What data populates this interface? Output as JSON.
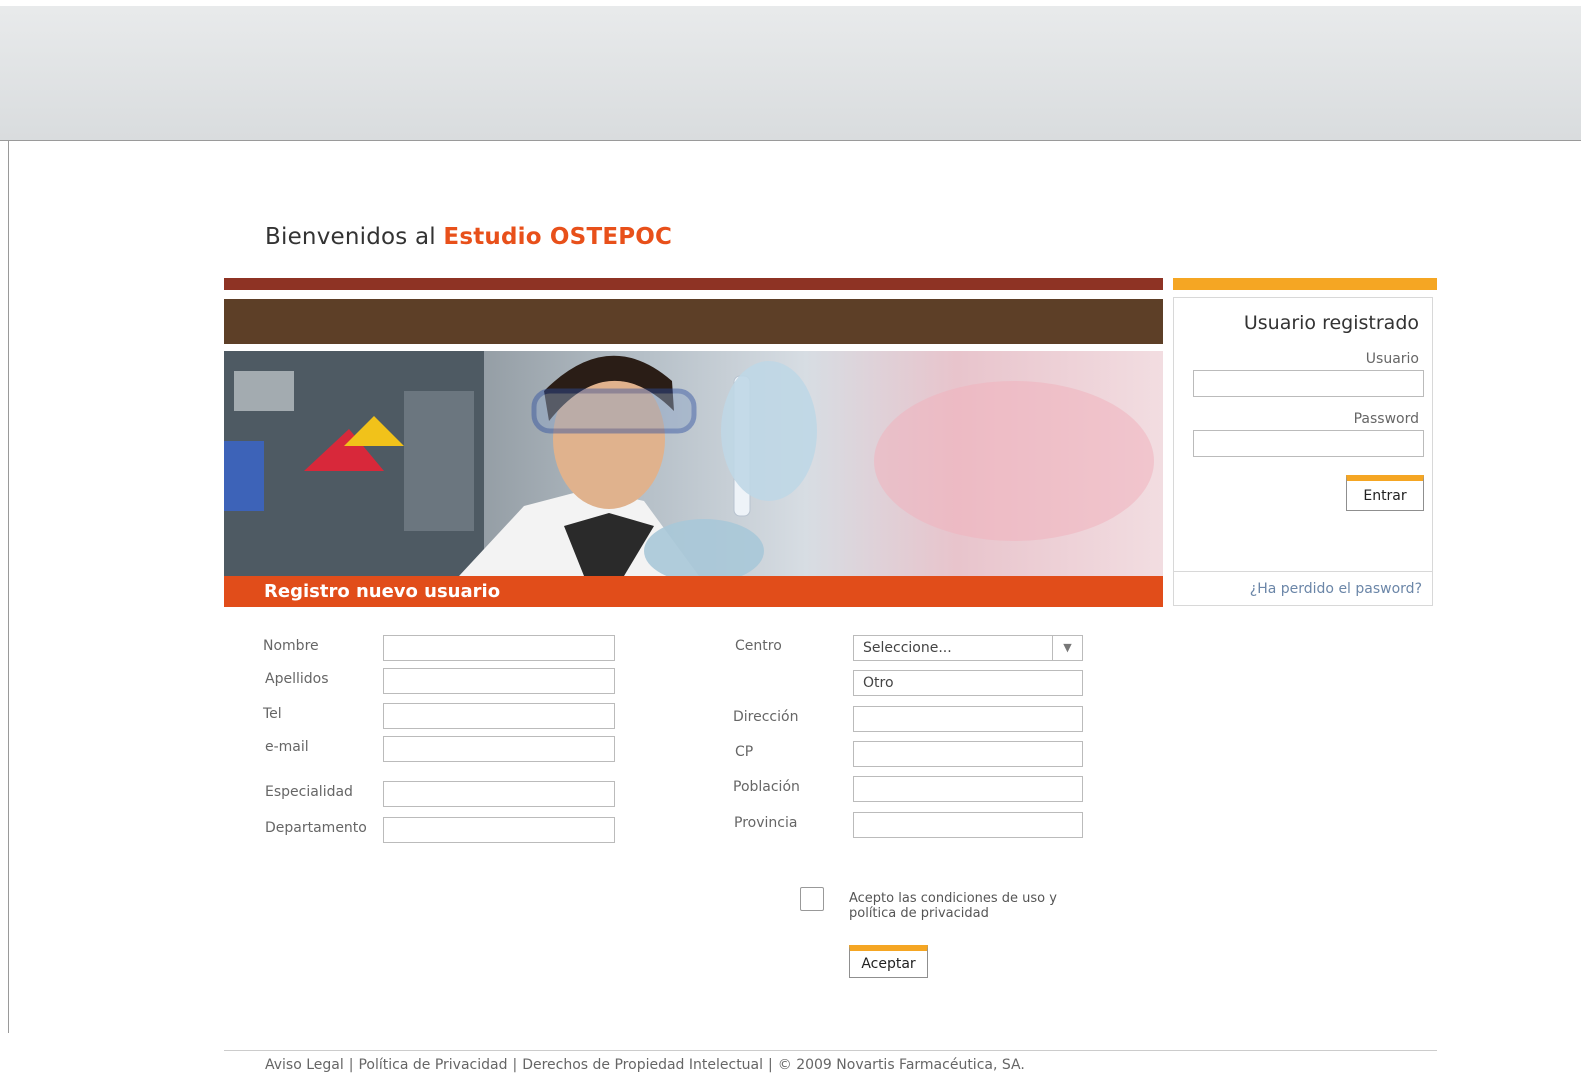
{
  "header": {
    "welcome_prefix": "Bienvenidos al",
    "welcome_brand": "Estudio OSTEPOC"
  },
  "registration": {
    "title": "Registro nuevo usuario",
    "left_fields": [
      {
        "label": "Nombre",
        "value": ""
      },
      {
        "label": "Apellidos",
        "value": ""
      },
      {
        "label": "Tel",
        "value": ""
      },
      {
        "label": "e-mail",
        "value": ""
      },
      {
        "label": "Especialidad",
        "value": ""
      },
      {
        "label": "Departamento",
        "value": ""
      }
    ],
    "right_fields": {
      "centro_label": "Centro",
      "centro_selected": "Seleccione...",
      "otro_value": "Otro",
      "direccion_label": "Dirección",
      "cp_label": "CP",
      "poblacion_label": "Población",
      "provincia_label": "Provincia"
    },
    "accept_terms": "Acepto las condiciones de uso y política de privacidad",
    "accept_checked": false,
    "submit_label": "Aceptar"
  },
  "login": {
    "title": "Usuario registrado",
    "user_label": "Usuario",
    "password_label": "Password",
    "submit_label": "Entrar",
    "forgot_link": "¿Ha perdido el pasword?"
  },
  "footer": {
    "links": [
      "Aviso Legal",
      "Política de Privacidad",
      "Derechos de Propiedad Intelectual"
    ],
    "copyright": "© 2009 Novartis Farmacéutica, SA."
  },
  "colors": {
    "brand_orange": "#e8501a",
    "banner_orange": "#e14d1a",
    "bar_red": "#8e3324",
    "bar_brown": "#5d3f27",
    "accent_yellow": "#f5a623"
  }
}
